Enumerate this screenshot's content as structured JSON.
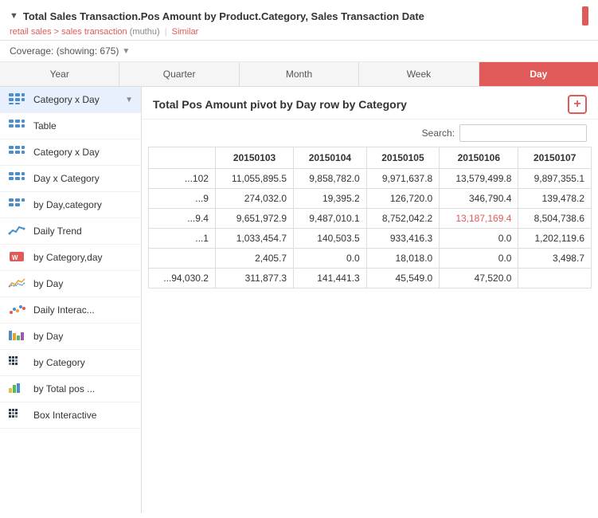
{
  "header": {
    "title": "Total Sales Transaction.Pos Amount by Product.Category, Sales Transaction Date",
    "breadcrumb_text": "retail sales > sales transaction",
    "breadcrumb_user": "muthu",
    "breadcrumb_similar": "Similar",
    "coverage_label": "Coverage: (showing: 675)"
  },
  "tabs": [
    {
      "label": "Year",
      "active": false
    },
    {
      "label": "Quarter",
      "active": false
    },
    {
      "label": "Month",
      "active": false
    },
    {
      "label": "Week",
      "active": false
    },
    {
      "label": "Day",
      "active": true
    }
  ],
  "sidebar": {
    "items": [
      {
        "id": "category-x-day-1",
        "label": "Category x Day",
        "icon": "grid",
        "active": true,
        "dropdown": true
      },
      {
        "id": "table",
        "label": "Table",
        "icon": "grid",
        "active": false,
        "dropdown": false
      },
      {
        "id": "category-x-day-2",
        "label": "Category x Day",
        "icon": "grid",
        "active": false,
        "dropdown": false
      },
      {
        "id": "day-x-category",
        "label": "Day x Category",
        "icon": "grid",
        "active": false,
        "dropdown": false
      },
      {
        "id": "by-day-category",
        "label": "by Day,category",
        "icon": "grid",
        "active": false,
        "dropdown": false
      },
      {
        "id": "daily-trend",
        "label": "Daily Trend",
        "icon": "trend",
        "active": false,
        "dropdown": false
      },
      {
        "id": "by-category-day",
        "label": "by Category,day",
        "icon": "word",
        "active": false,
        "dropdown": false
      },
      {
        "id": "by-day-1",
        "label": "by Day",
        "icon": "line",
        "active": false,
        "dropdown": false
      },
      {
        "id": "daily-interac",
        "label": "Daily Interac...",
        "icon": "dots",
        "active": false,
        "dropdown": false
      },
      {
        "id": "by-day-2",
        "label": "by Day",
        "icon": "bar-colored",
        "active": false,
        "dropdown": false
      },
      {
        "id": "by-category",
        "label": "by Category",
        "icon": "pixel",
        "active": false,
        "dropdown": false
      },
      {
        "id": "by-total-pos",
        "label": "by Total pos ...",
        "icon": "bar-gradient",
        "active": false,
        "dropdown": false
      },
      {
        "id": "box-interactive",
        "label": "Box Interactive",
        "icon": "pixel2",
        "active": false,
        "dropdown": false
      }
    ]
  },
  "content": {
    "title": "Total Pos Amount pivot by Day row by Category",
    "search_label": "Search:",
    "search_placeholder": "",
    "add_button_label": "+",
    "columns": [
      "",
      "20150103",
      "20150104",
      "20150105",
      "20150106",
      "20150107"
    ],
    "rows": [
      {
        "cells": [
          "...102",
          "11,055,895.5",
          "9,858,782.0",
          "9,971,637.8",
          "13,579,499.8",
          "9,897,355.1"
        ],
        "red": []
      },
      {
        "cells": [
          "...9",
          "274,032.0",
          "19,395.2",
          "126,720.0",
          "346,790.4",
          "139,478.2"
        ],
        "red": []
      },
      {
        "cells": [
          "...9.4",
          "9,651,972.9",
          "9,487,010.1",
          "8,752,042.2",
          "13,187,169.4",
          "8,504,738.6"
        ],
        "red": [
          4
        ]
      },
      {
        "cells": [
          "...1",
          "1,033,454.7",
          "140,503.5",
          "933,416.3",
          "0.0",
          "1,202,119.6"
        ],
        "red": []
      },
      {
        "cells": [
          "",
          "2,405.7",
          "0.0",
          "18,018.0",
          "0.0",
          "3,498.7"
        ],
        "red": []
      },
      {
        "cells": [
          "...94,030.2",
          "311,877.3",
          "141,441.3",
          "45,549.0",
          "47,520.0",
          ""
        ],
        "red": []
      }
    ]
  },
  "colors": {
    "accent": "#e05a5a",
    "active_tab_bg": "#e05a5a",
    "active_tab_text": "#ffffff",
    "grid_icon": "#4a8fcc",
    "sidebar_active_bg": "#e8f0fe"
  }
}
